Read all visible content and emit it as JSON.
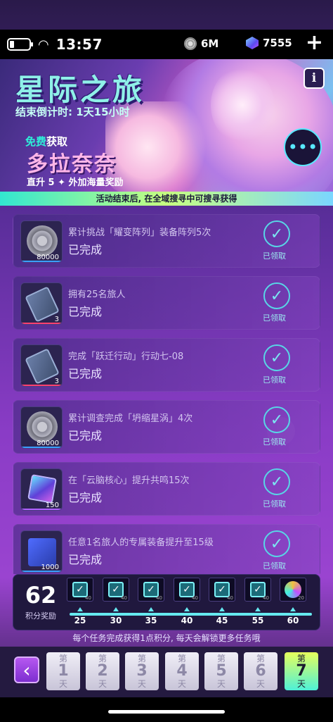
{
  "status_bar": {
    "time": "13:57",
    "coins": "6M",
    "gems": "7555",
    "plus": "+"
  },
  "banner": {
    "title": "星际之旅",
    "countdown": "结束倒计时: 1天15小时",
    "free_prefix": "免费",
    "free_suffix": "获取",
    "character_name": "多拉奈奈",
    "level_up": "直升 5 ✦ 外加海量奖励",
    "info": "i",
    "note": "活动结束后, 在全域搜寻中可搜寻获得"
  },
  "tasks": [
    {
      "title": "累计挑战「耀变阵列」装备阵列5次",
      "status": "已完成",
      "reward_qty": "80000",
      "reward_icon": "coin-gear-icon",
      "claimed": "已领取"
    },
    {
      "title": "拥有25名旅人",
      "status": "已完成",
      "reward_qty": "3",
      "reward_icon": "ticket-icon",
      "claimed": "已领取"
    },
    {
      "title": "完成「跃迁行动」行动七-08",
      "status": "已完成",
      "reward_qty": "3",
      "reward_icon": "ticket-icon",
      "claimed": "已领取"
    },
    {
      "title": "累计调查完成「坍缩星涡」4次",
      "status": "已完成",
      "reward_qty": "80000",
      "reward_icon": "coin-gear-icon",
      "claimed": "已领取"
    },
    {
      "title": "在「云脑核心」提升共鸣15次",
      "status": "已完成",
      "reward_qty": "150",
      "reward_icon": "cube-icon",
      "claimed": "已领取"
    },
    {
      "title": "任意1名旅人的专属装备提升至15级",
      "status": "已完成",
      "reward_qty": "1000",
      "reward_icon": "blocks-icon",
      "claimed": "已领取"
    }
  ],
  "points": {
    "value": "62",
    "label": "积分奖励",
    "milestones": [
      {
        "value": "25",
        "mini": "40"
      },
      {
        "value": "30",
        "mini": "40"
      },
      {
        "value": "35",
        "mini": "40"
      },
      {
        "value": "40",
        "mini": "40"
      },
      {
        "value": "45",
        "mini": "40"
      },
      {
        "value": "55",
        "mini": "40"
      },
      {
        "value": "60",
        "mini": "20"
      }
    ]
  },
  "footer_note": "每个任务完成获得1点积分, 每天会解锁更多任务哦",
  "days": [
    {
      "top": "第",
      "num": "1",
      "bottom": "天"
    },
    {
      "top": "第",
      "num": "2",
      "bottom": "天"
    },
    {
      "top": "第",
      "num": "3",
      "bottom": "天"
    },
    {
      "top": "第",
      "num": "4",
      "bottom": "天"
    },
    {
      "top": "第",
      "num": "5",
      "bottom": "天"
    },
    {
      "top": "第",
      "num": "6",
      "bottom": "天"
    },
    {
      "top": "第",
      "num": "7",
      "bottom": "天"
    }
  ],
  "back_glyph": "‹"
}
